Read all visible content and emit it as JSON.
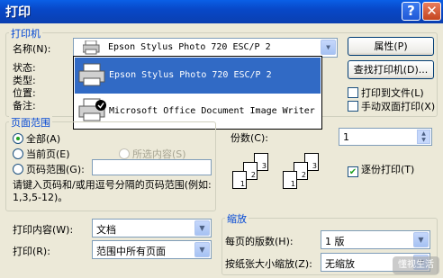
{
  "window": {
    "title": "打印",
    "help_glyph": "?",
    "close_glyph": "✕"
  },
  "printer": {
    "group_title": "打印机",
    "name_label": "名称(N):",
    "selected": "Epson Stylus Photo 720 ESC/P 2",
    "status_label": "状态:",
    "type_label": "类型:",
    "where_label": "位置:",
    "comment_label": "备注:",
    "properties_button": "属性(P)",
    "find_button": "查找打印机(D)...",
    "print_to_file": "打印到文件(L)",
    "manual_duplex": "手动双面打印(X)",
    "dropdown_items": [
      "Epson Stylus Photo 720 ESC/P 2",
      "Microsoft Office Document Image Writer"
    ]
  },
  "page_range": {
    "group_title": "页面范围",
    "all": "全部(A)",
    "current": "当前页(E)",
    "selection": "所选内容(S)",
    "pages": "页码范围(G):",
    "pages_value": "",
    "hint": "请键入页码和/或用逗号分隔的页码范围(例如: 1,3,5-12)。"
  },
  "copies": {
    "label": "份数(C):",
    "value": "1",
    "collate": "逐份打印(T)",
    "collate_checked": true,
    "page_numbers": [
      "1",
      "2",
      "3"
    ]
  },
  "print_what": {
    "label": "打印内容(W):",
    "value": "文档"
  },
  "print": {
    "label": "打印(R):",
    "value": "范围中所有页面"
  },
  "zoom": {
    "group_title": "缩放",
    "pages_per_sheet_label": "每页的版数(H):",
    "pages_per_sheet_value": "1 版",
    "scale_label": "按纸张大小缩放(Z):",
    "scale_value": "无缩放"
  },
  "watermark_text": "懂视生活"
}
